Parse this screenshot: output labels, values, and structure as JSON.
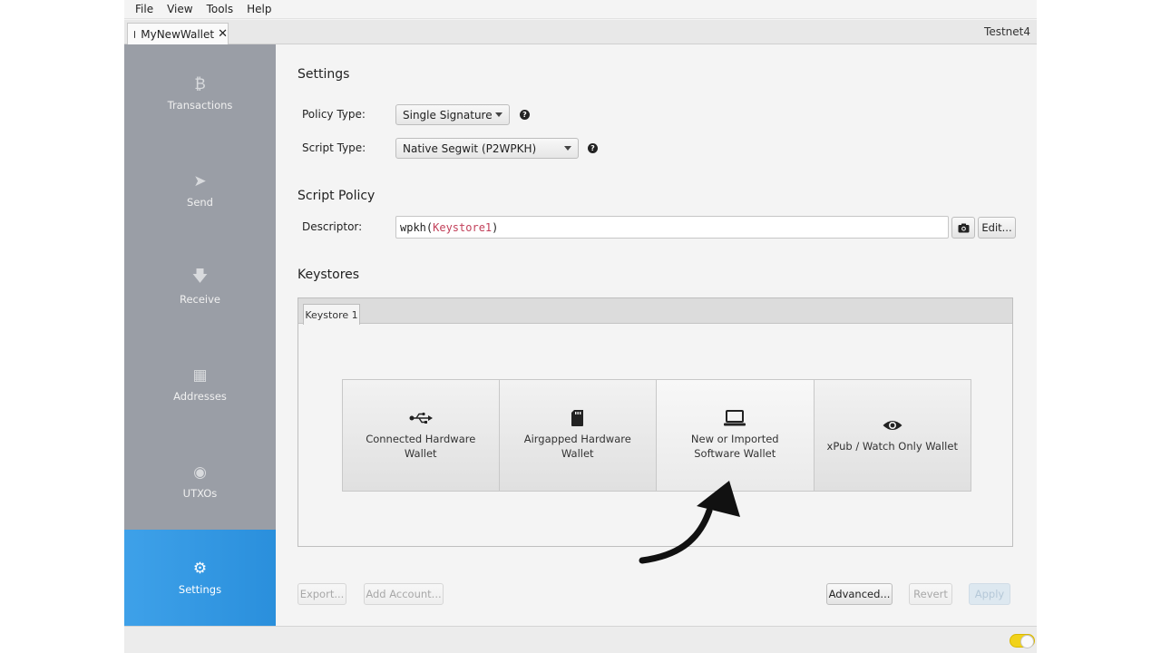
{
  "menu": [
    "File",
    "View",
    "Tools",
    "Help"
  ],
  "tab": {
    "label": "MyNewWallet",
    "close": "✕"
  },
  "network": "Testnet4",
  "sidebar": {
    "items": [
      {
        "label": "Transactions",
        "icon": "bitcoin-icon",
        "glyph": "₿"
      },
      {
        "label": "Send",
        "icon": "paper-plane-icon",
        "glyph": "➤"
      },
      {
        "label": "Receive",
        "icon": "arrow-down-icon",
        "glyph": "🡇"
      },
      {
        "label": "Addresses",
        "icon": "table-icon",
        "glyph": "▦"
      },
      {
        "label": "UTXOs",
        "icon": "coins-icon",
        "glyph": "◉"
      },
      {
        "label": "Settings",
        "icon": "gear-icon",
        "glyph": "⚙"
      }
    ],
    "active": "Settings"
  },
  "settings": {
    "title": "Settings",
    "policy_label": "Policy Type:",
    "policy_value": "Single Signature",
    "script_label": "Script Type:",
    "script_value": "Native Segwit (P2WPKH)"
  },
  "script_policy": {
    "title": "Script Policy",
    "descriptor_label": "Descriptor:",
    "descriptor_fn": "wpkh(",
    "descriptor_key": "Keystore1",
    "descriptor_close": ")",
    "edit_label": "Edit..."
  },
  "keystores": {
    "title": "Keystores",
    "tab": "Keystore 1",
    "types": [
      {
        "label": "Connected Hardware Wallet",
        "icon": "usb-icon",
        "glyph": "⭠"
      },
      {
        "label": "Airgapped Hardware Wallet",
        "icon": "sd-card-icon",
        "glyph": "▮"
      },
      {
        "label": "New or Imported Software Wallet",
        "icon": "laptop-icon",
        "glyph": "💻"
      },
      {
        "label": "xPub / Watch Only Wallet",
        "icon": "eye-icon",
        "glyph": "👁"
      }
    ]
  },
  "footer": {
    "export": "Export...",
    "add_account": "Add Account...",
    "advanced": "Advanced...",
    "revert": "Revert",
    "apply": "Apply"
  },
  "colors": {
    "accent": "#2a8fdc",
    "sidebar": "#9a9ea6",
    "toggle": "#f1d21b",
    "keyword": "#c2405a"
  }
}
